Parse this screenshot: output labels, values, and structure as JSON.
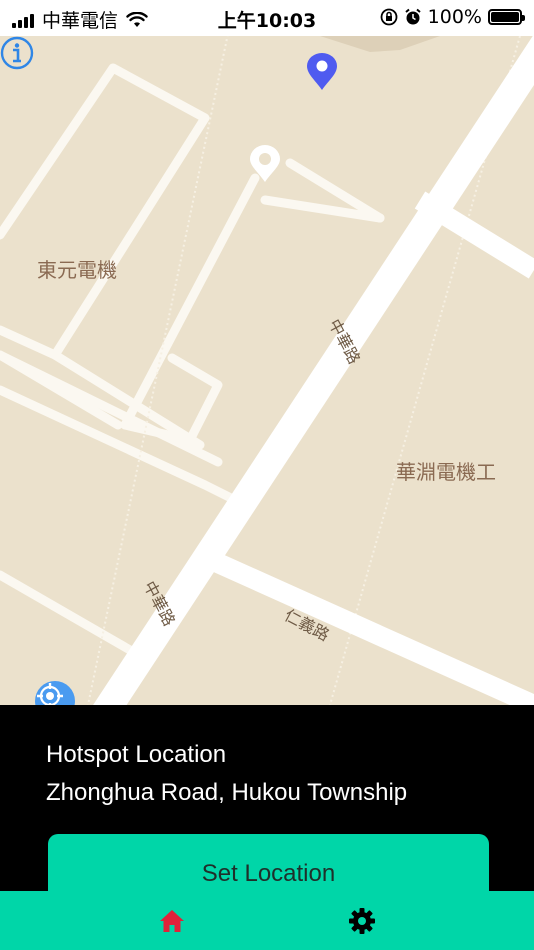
{
  "status_bar": {
    "carrier": "中華電信",
    "time": "上午10:03",
    "battery_percent": "100%",
    "battery_level": 1.0,
    "icons": [
      "signal-icon",
      "wifi-icon",
      "orientation-lock-icon",
      "alarm-icon",
      "battery-icon"
    ]
  },
  "map": {
    "labels": {
      "place_1": "東元電機",
      "place_2": "華淵電機工"
    },
    "road_labels": {
      "road_1": "中華路",
      "road_2": "中華路",
      "road_3": "仁義路"
    },
    "colors": {
      "land": "#ebe1cc",
      "road": "#ffffff",
      "pin": "#4f5bf0",
      "locate": "#4a9bf0",
      "info": "#2f86e6"
    },
    "icons": [
      "location-pin-icon",
      "hotspot-marker-icon",
      "locate-me-icon",
      "info-icon"
    ]
  },
  "panel": {
    "title": "Hotspot Location",
    "address": "Zhonghua Road, Hukou Township",
    "set_button": "Set Location"
  },
  "tab_bar": {
    "tabs": [
      {
        "icon": "home-icon",
        "active": true,
        "color": "#e0223a"
      },
      {
        "icon": "gear-icon",
        "active": false,
        "color": "#000000"
      }
    ],
    "background": "#00d6a8"
  }
}
